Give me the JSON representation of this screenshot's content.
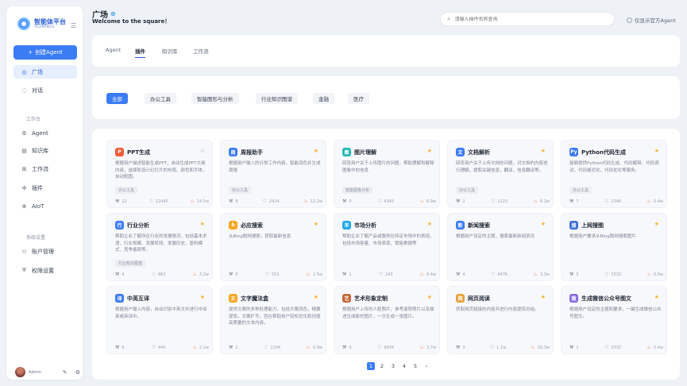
{
  "brand": {
    "name": "智能体平台",
    "sub": "TERMINUS",
    "collapse_icon": "menu-icon"
  },
  "sidebar": {
    "create_label": "创建Agent",
    "nav_top": [
      {
        "label": "广场",
        "icon": "square-icon",
        "active": true
      },
      {
        "label": "对话",
        "icon": "chat-icon",
        "active": false
      }
    ],
    "section_workspace": "工作台",
    "nav_workspace": [
      {
        "label": "Agent",
        "icon": "agent-icon"
      },
      {
        "label": "知识库",
        "icon": "book-icon"
      },
      {
        "label": "工作流",
        "icon": "flow-icon"
      },
      {
        "label": "插件",
        "icon": "plugin-icon"
      },
      {
        "label": "AIoT",
        "icon": "aiot-icon"
      }
    ],
    "section_system": "系统设置",
    "nav_system": [
      {
        "label": "账户管理",
        "icon": "user-icon"
      },
      {
        "label": "权限设置",
        "icon": "shield-icon"
      }
    ],
    "user": {
      "name": "Admin"
    }
  },
  "header": {
    "title": "广场",
    "subtitle": "Welcome to the square！",
    "search_placeholder": "请输入插件名称查询",
    "official_only": "仅显示官方Agent"
  },
  "tabs": [
    "Agent",
    "插件",
    "知识库",
    "工作流"
  ],
  "active_tab": 1,
  "filters": [
    "全部",
    "办公工具",
    "智能图形与分析",
    "行业知识图谱",
    "金融",
    "医疗"
  ],
  "active_filter": 0,
  "cards": [
    {
      "title": "PPT生成",
      "icon": "ppt-icon",
      "icon_bg": "#f25c3b",
      "icon_char": "P",
      "starred": false,
      "desc": "根据用户描述智能生成PPT，自动生成PPT大纲内容，选择和设计幻灯片的布局、颜色和字体，自动配图。",
      "tag": "办公工具",
      "uses": "12",
      "likes": "12445",
      "heat": "14.5w"
    },
    {
      "title": "周报助手",
      "icon": "report-icon",
      "icon_bg": "#3b7cf5",
      "icon_char": "周",
      "starred": true,
      "desc": "根据用户输入的日常工作内容，智能润色并生成周报",
      "tag": "办公工具",
      "uses": "8",
      "likes": "2424",
      "heat": "12.2w"
    },
    {
      "title": "图片理解",
      "icon": "image-icon",
      "icon_bg": "#22b8b0",
      "icon_char": "图",
      "starred": true,
      "desc": "回答用户关于上传图片的问题，帮助理解和解释图像中的信息",
      "tag": "智能图像分析",
      "uses": "5",
      "likes": "4345",
      "heat": "8.9w"
    },
    {
      "title": "文档解析",
      "icon": "doc-icon",
      "icon_bg": "#3b7cf5",
      "icon_char": "文",
      "starred": true,
      "desc": "回答用户关于上传文档的问题，对文档的内容进行理解，提取关键信息，翻译，信息翻译等。",
      "tag": "办公工具",
      "uses": "2",
      "likes": "2223",
      "heat": "6.2w"
    },
    {
      "title": "Python代码生成",
      "icon": "code-icon",
      "icon_bg": "#3b7cf5",
      "icon_char": "Py",
      "starred": true,
      "desc": "能够提供Python代码生成、代码解释、代码调试，代码格式化，代码优化等服务。",
      "tag": "办公工具",
      "uses": "7",
      "likes": "2346",
      "heat": "5.4w"
    },
    {
      "title": "行业分析",
      "icon": "chart-icon",
      "icon_bg": "#3b7cf5",
      "icon_char": "行",
      "starred": true,
      "desc": "帮助企业了解所在行业的发展情况，包括基本术语、行业规模、发展阶段、发展历史、盈利模式、竞争格局等。",
      "tag": "行业知识图谱",
      "uses": "4",
      "likes": "863",
      "heat": "3.2w"
    },
    {
      "title": "必应搜索",
      "icon": "bing-icon",
      "icon_bg": "#f5a623",
      "icon_char": "b",
      "starred": true,
      "desc": "从Bing联网搜索，获取最新信息",
      "tag": "",
      "uses": "0",
      "likes": "552",
      "heat": "2.5w"
    },
    {
      "title": "市场分析",
      "icon": "market-icon",
      "icon_bg": "#22a8e8",
      "icon_char": "市",
      "starred": true,
      "desc": "帮助企业了解产品或服务在特定市场中的表现，包括市场容量、市场表现、销售数据等",
      "tag": "",
      "uses": "1",
      "likes": "243",
      "heat": "0.4w"
    },
    {
      "title": "新闻搜索",
      "icon": "news-icon",
      "icon_bg": "#3b7cf5",
      "icon_char": "新",
      "starred": true,
      "desc": "根据用户设定的主题，搜索最新新闻资讯",
      "tag": "",
      "uses": "4",
      "likes": "4476",
      "heat": "3.3w"
    },
    {
      "title": "上网搜图",
      "icon": "image-search-icon",
      "icon_bg": "#3b6fd6",
      "icon_char": "搜",
      "starred": true,
      "desc": "根据用户要求从Bing联网搜索图片",
      "tag": "",
      "uses": "5",
      "likes": "1532",
      "heat": "0.9w"
    },
    {
      "title": "中英互译",
      "icon": "translate-icon",
      "icon_bg": "#3b7cf5",
      "icon_char": "译",
      "starred": true,
      "desc": "根据用户输入内容，自动识别中英文并进行中译英或英译中。",
      "tag": "",
      "uses": "6",
      "likes": "440",
      "heat": "2.1w"
    },
    {
      "title": "文字魔法盒",
      "icon": "magic-box-icon",
      "icon_bg": "#f5a623",
      "icon_char": "文",
      "starred": true,
      "desc": "提供文案的多种处理能力，包括文案润色，精要提炼，文案扩写，旨在帮助用户轻松优化和创造高质量的文本内容。",
      "tag": "",
      "uses": "2",
      "likes": "2234",
      "heat": "0.9w"
    },
    {
      "title": "艺术形象定制",
      "icon": "art-icon",
      "icon_bg": "#c76a3b",
      "icon_char": "艺",
      "starred": true,
      "desc": "根据用户上传的人脸照片，参考姿势照片以及描述生成新的图片，一次生成一张图片。",
      "tag": "",
      "uses": "0",
      "likes": "6934",
      "heat": "3.7w"
    },
    {
      "title": "网页阅读",
      "icon": "web-reader-icon",
      "icon_bg": "#e8a33b",
      "icon_char": "网",
      "starred": true,
      "desc": "获取网页链接的内容并进行内容提炼总结。",
      "tag": "",
      "uses": "3",
      "likes": "1.1w",
      "heat": "10.3w"
    },
    {
      "title": "生成微信公众号图文",
      "icon": "wechat-article-icon",
      "icon_bg": "#8a6be0",
      "icon_char": "微",
      "starred": true,
      "desc": "根据用户设定的主题和要求，一键生成微信公众号图文。",
      "tag": "",
      "uses": "1",
      "likes": "3332",
      "heat": "5.4w"
    }
  ],
  "pagination": {
    "pages": [
      "1",
      "2",
      "3",
      "4",
      "5"
    ],
    "active": 0,
    "next_icon": "chevron-right-icon"
  },
  "colors": {
    "accent": "#3b7cf5",
    "star": "#f5b43b",
    "fire": "#f06a3a"
  }
}
